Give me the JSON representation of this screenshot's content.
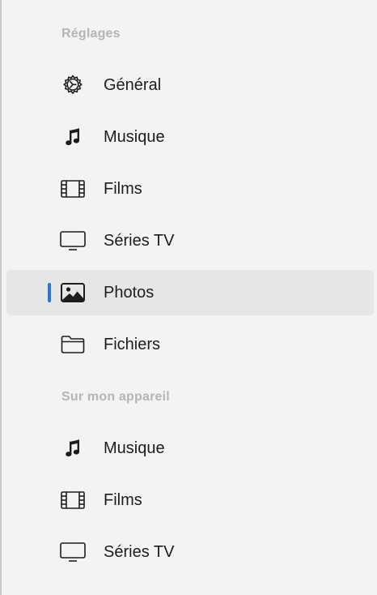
{
  "sidebar": {
    "sections": {
      "settings_header": "Réglages",
      "device_header": "Sur mon appareil"
    },
    "settings_items": [
      {
        "label": "Général",
        "icon": "gear-icon"
      },
      {
        "label": "Musique",
        "icon": "music-note-icon"
      },
      {
        "label": "Films",
        "icon": "film-icon"
      },
      {
        "label": "Séries TV",
        "icon": "tv-icon"
      },
      {
        "label": "Photos",
        "icon": "photo-icon",
        "selected": true
      },
      {
        "label": "Fichiers",
        "icon": "folder-icon"
      }
    ],
    "device_items": [
      {
        "label": "Musique",
        "icon": "music-note-icon"
      },
      {
        "label": "Films",
        "icon": "film-icon"
      },
      {
        "label": "Séries TV",
        "icon": "tv-icon"
      }
    ]
  },
  "colors": {
    "accent": "#2f6fe0",
    "background": "#f3f3f3",
    "selected_background": "#e6e6e6",
    "header_text": "#b5b5b5",
    "label_text": "#1d1d1f"
  }
}
